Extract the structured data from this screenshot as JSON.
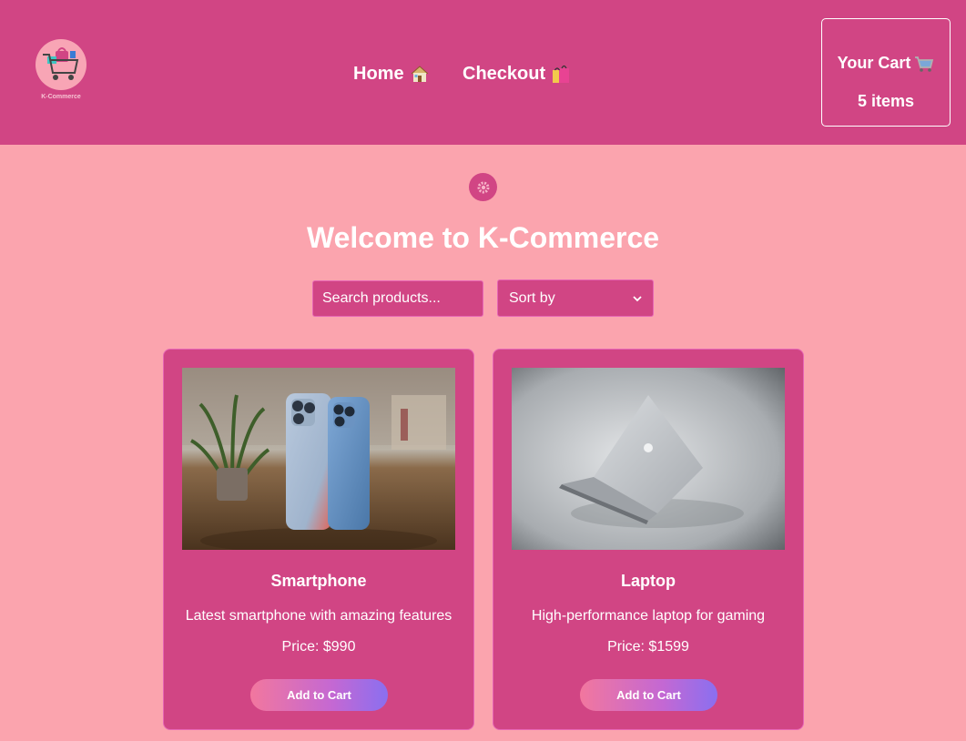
{
  "brand": {
    "logo_text": "K-Commerce"
  },
  "nav": {
    "home": {
      "label": "Home",
      "icon": "house-icon"
    },
    "checkout": {
      "label": "Checkout",
      "icon": "shopping-bags-icon"
    }
  },
  "cart": {
    "title": "Your Cart",
    "icon": "shopping-cart-icon",
    "count": "5 items"
  },
  "theme_toggle": {
    "icon": "gear-icon"
  },
  "welcome": "Welcome to K-Commerce",
  "search": {
    "placeholder": "Search products...",
    "value": ""
  },
  "sort": {
    "selected": "Sort by"
  },
  "products": [
    {
      "name": "Smartphone",
      "description": "Latest smartphone with amazing features",
      "price_label": "Price: $",
      "price": "990",
      "button": "Add to Cart",
      "image": "smartphone-photo"
    },
    {
      "name": "Laptop",
      "description": "High-performance laptop for gaming",
      "price_label": "Price: $",
      "price": "1599",
      "button": "Add to Cart",
      "image": "laptop-photo"
    }
  ],
  "colors": {
    "background": "#fba4ae",
    "header": "#d14584",
    "card": "#d14584",
    "text": "#ffffff"
  }
}
